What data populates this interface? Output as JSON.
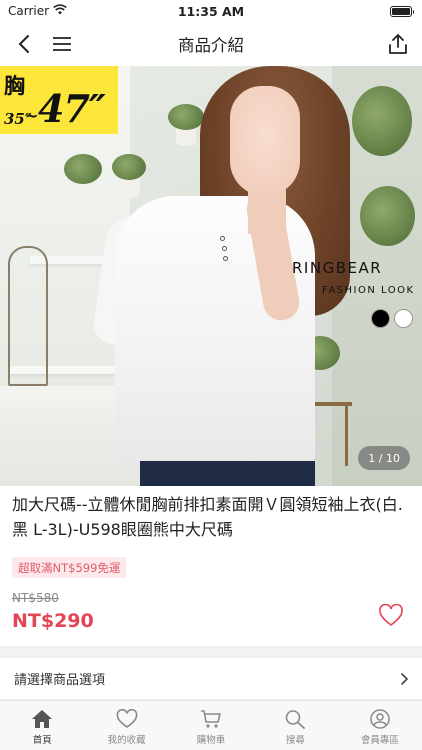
{
  "status_bar": {
    "carrier": "Carrier",
    "time": "11:35 AM"
  },
  "nav": {
    "title": "商品介紹",
    "back_icon": "chevron-left-icon",
    "menu_icon": "hamburger-icon",
    "share_icon": "share-icon"
  },
  "product_image": {
    "size_banner": {
      "chest": "胸",
      "from": "35″",
      "tilde": "~",
      "to": "47″"
    },
    "brand": {
      "logo": "RINGBEAR",
      "tagline": "FASHION LOOK"
    },
    "color_swatches": [
      "#000000",
      "#ffffff"
    ],
    "page_indicator": "1 / 10"
  },
  "product": {
    "title": "加大尺碼--立體休閒胸前排扣素面開Ｖ圓領短袖上衣(白.黑 L-3L)-U598眼圈熊中大尺碼",
    "promo": "超取滿NT$599免運",
    "original_price": "NT$580",
    "price": "NT$290"
  },
  "options": {
    "label": "請選擇商品選項"
  },
  "tab_bar": {
    "items": [
      {
        "label": "首頁",
        "icon": "home-icon",
        "active": true
      },
      {
        "label": "我的收藏",
        "icon": "heart-icon",
        "active": false
      },
      {
        "label": "購物車",
        "icon": "cart-icon",
        "active": false
      },
      {
        "label": "搜尋",
        "icon": "search-icon",
        "active": false
      },
      {
        "label": "會員專區",
        "icon": "user-icon",
        "active": false
      }
    ]
  },
  "colors": {
    "price_red": "#e44556",
    "promo_bg": "#fde8ea",
    "banner_yellow": "#fce63a"
  }
}
